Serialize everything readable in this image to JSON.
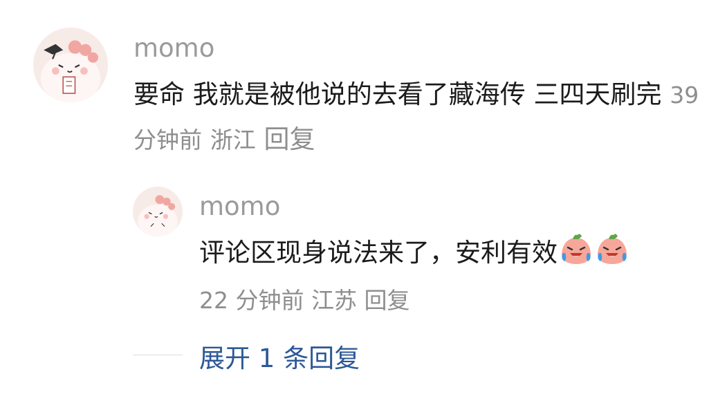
{
  "comments": [
    {
      "username": "momo",
      "text": "要命 我就是被他说的去看了藏海传 三四天刷完",
      "time": "39 分钟前",
      "location": "浙江",
      "reply_label": "回复"
    }
  ],
  "replies": [
    {
      "username": "momo",
      "text": "评论区现身说法来了，安利有效",
      "emojis": [
        "laughing-crying-emoji",
        "laughing-crying-emoji"
      ],
      "time": "22 分钟前",
      "location": "江苏",
      "reply_label": "回复"
    }
  ],
  "expand": {
    "label": "展开 1 条回复"
  },
  "colors": {
    "username": "#9a9a9a",
    "text": "#1b1b1b",
    "meta": "#8e8e8e",
    "link": "#2c5896"
  }
}
